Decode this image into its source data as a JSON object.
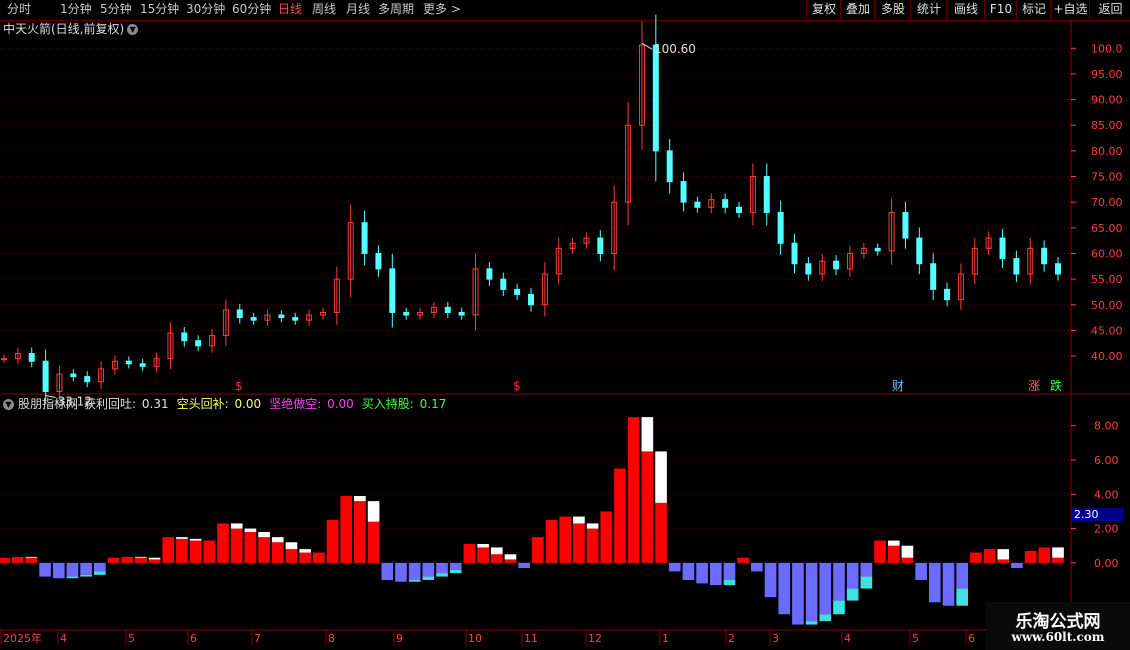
{
  "toolbar": {
    "timeframes": [
      "分时",
      "1分钟",
      "5分钟",
      "15分钟",
      "30分钟",
      "60分钟",
      "日线",
      "周线",
      "月线",
      "多周期",
      "更多 >"
    ],
    "active_timeframe": "日线",
    "buttons": [
      "复权",
      "叠加",
      "多股",
      "统计",
      "画线",
      "F10",
      "标记",
      "+自选",
      "返回"
    ]
  },
  "main_chart": {
    "title": "中天火箭(日线,前复权)",
    "high_label": "100.60",
    "low_label": "33.12",
    "yticks": [
      "100.0",
      "95.00",
      "90.00",
      "85.00",
      "80.00",
      "75.00",
      "70.00",
      "65.00",
      "60.00",
      "55.00",
      "50.00",
      "45.00",
      "40.00"
    ],
    "markers": [
      "$",
      "$",
      "财",
      "涨",
      "跌"
    ]
  },
  "indicator": {
    "name": "股朋指标网",
    "items": [
      {
        "label": "获利回吐:",
        "value": "0.31",
        "color": "#e0e0e0"
      },
      {
        "label": "空头回补:",
        "value": "0.00",
        "color": "#ffff60"
      },
      {
        "label": "坚绝做空:",
        "value": "0.00",
        "color": "#ff40ff"
      },
      {
        "label": "买入持股:",
        "value": "0.17",
        "color": "#40ff40"
      }
    ],
    "yticks": [
      "8.00",
      "6.00",
      "4.00",
      "2.00",
      "0.00"
    ],
    "current_value": "2.30"
  },
  "xaxis": {
    "labels": [
      "2025年",
      "4",
      "5",
      "6",
      "7",
      "8",
      "9",
      "10",
      "11",
      "12",
      "1",
      "2",
      "3",
      "4",
      "5",
      "6"
    ]
  },
  "watermark": {
    "line1": "乐淘公式网",
    "line2": "www.60lt.com"
  },
  "colors": {
    "up": "#ff3c3c",
    "down": "#54ffff",
    "hist_pos": "#ff0000",
    "hist_neg": "#6b6bff",
    "grid": "#5a0000"
  },
  "chart_data": {
    "type": "candlestick",
    "price_series": [
      {
        "x": "2025-03",
        "close": 39.5
      },
      {
        "x": "2025-03",
        "close": 40.5
      },
      {
        "x": "2025-03",
        "close": 39.0
      },
      {
        "x": "2025-04",
        "close": 33.1
      },
      {
        "x": "2025-04",
        "close": 36.5
      },
      {
        "x": "2025-04",
        "close": 36.0
      },
      {
        "x": "2025-04",
        "close": 35.0
      },
      {
        "x": "2025-04",
        "close": 37.5
      },
      {
        "x": "2025-05",
        "close": 39.0
      },
      {
        "x": "2025-05",
        "close": 38.5
      },
      {
        "x": "2025-05",
        "close": 38.0
      },
      {
        "x": "2025-05",
        "close": 39.5
      },
      {
        "x": "2025-06",
        "close": 44.5
      },
      {
        "x": "2025-06",
        "close": 43.0
      },
      {
        "x": "2025-06",
        "close": 42.0
      },
      {
        "x": "2025-06",
        "close": 44.0
      },
      {
        "x": "2025-07",
        "close": 49.0
      },
      {
        "x": "2025-07",
        "close": 47.5
      },
      {
        "x": "2025-07",
        "close": 47.0
      },
      {
        "x": "2025-07",
        "close": 48.0
      },
      {
        "x": "2025-07",
        "close": 47.5
      },
      {
        "x": "2025-08",
        "close": 47.0
      },
      {
        "x": "2025-08",
        "close": 48.0
      },
      {
        "x": "2025-08",
        "close": 48.5
      },
      {
        "x": "2025-08",
        "close": 55.0
      },
      {
        "x": "2025-08",
        "close": 66.0
      },
      {
        "x": "2025-09",
        "close": 60.0
      },
      {
        "x": "2025-09",
        "close": 57.0
      },
      {
        "x": "2025-09",
        "close": 48.5
      },
      {
        "x": "2025-09",
        "close": 48.0
      },
      {
        "x": "2025-10",
        "close": 48.5
      },
      {
        "x": "2025-10",
        "close": 49.5
      },
      {
        "x": "2025-10",
        "close": 48.5
      },
      {
        "x": "2025-10",
        "close": 48.0
      },
      {
        "x": "2025-11",
        "close": 57.0
      },
      {
        "x": "2025-11",
        "close": 55.0
      },
      {
        "x": "2025-11",
        "close": 53.0
      },
      {
        "x": "2025-11",
        "close": 52.0
      },
      {
        "x": "2025-11",
        "close": 50.0
      },
      {
        "x": "2025-12",
        "close": 56.0
      },
      {
        "x": "2025-12",
        "close": 61.0
      },
      {
        "x": "2025-12",
        "close": 62.0
      },
      {
        "x": "2025-12",
        "close": 63.0
      },
      {
        "x": "2025-12",
        "close": 60.0
      },
      {
        "x": "2026-01",
        "close": 70.0
      },
      {
        "x": "2026-01",
        "close": 85.0
      },
      {
        "x": "2026-01",
        "close": 100.6
      },
      {
        "x": "2026-01",
        "close": 80.0
      },
      {
        "x": "2026-01",
        "close": 74.0
      },
      {
        "x": "2026-02",
        "close": 70.0
      },
      {
        "x": "2026-02",
        "close": 69.0
      },
      {
        "x": "2026-02",
        "close": 70.5
      },
      {
        "x": "2026-02",
        "close": 69.0
      },
      {
        "x": "2026-03",
        "close": 68.0
      },
      {
        "x": "2026-03",
        "close": 75.0
      },
      {
        "x": "2026-03",
        "close": 68.0
      },
      {
        "x": "2026-03",
        "close": 62.0
      },
      {
        "x": "2026-03",
        "close": 58.0
      },
      {
        "x": "2026-04",
        "close": 56.0
      },
      {
        "x": "2026-04",
        "close": 58.5
      },
      {
        "x": "2026-04",
        "close": 57.0
      },
      {
        "x": "2026-04",
        "close": 60.0
      },
      {
        "x": "2026-04",
        "close": 61.0
      },
      {
        "x": "2026-05",
        "close": 60.5
      },
      {
        "x": "2026-05",
        "close": 68.0
      },
      {
        "x": "2026-05",
        "close": 63.0
      },
      {
        "x": "2026-05",
        "close": 58.0
      },
      {
        "x": "2026-05",
        "close": 53.0
      },
      {
        "x": "2026-05",
        "close": 51.0
      },
      {
        "x": "2026-06",
        "close": 56.0
      },
      {
        "x": "2026-06",
        "close": 61.0
      },
      {
        "x": "2026-06",
        "close": 63.0
      },
      {
        "x": "2026-06",
        "close": 59.0
      },
      {
        "x": "2026-06",
        "close": 56.0
      },
      {
        "x": "2026-06",
        "close": 61.0
      },
      {
        "x": "2026-06",
        "close": 58.0
      },
      {
        "x": "2026-06",
        "close": 56.0
      }
    ],
    "hist_series": [
      0.3,
      0.35,
      0.3,
      -0.8,
      -0.9,
      -0.8,
      -0.7,
      -0.5,
      0.3,
      0.35,
      0.3,
      0.2,
      1.5,
      1.4,
      1.3,
      1.3,
      2.3,
      2.0,
      1.8,
      1.5,
      1.2,
      0.8,
      0.6,
      0.6,
      2.5,
      3.9,
      3.6,
      2.4,
      -1.0,
      -1.1,
      -1.0,
      -0.8,
      -0.6,
      -0.4,
      1.1,
      0.9,
      0.5,
      0.2,
      -0.3,
      1.5,
      2.5,
      2.7,
      2.3,
      2.0,
      3.0,
      5.5,
      8.5,
      6.5,
      3.5,
      -0.5,
      -1.0,
      -1.2,
      -1.3,
      -1.0,
      0.3,
      -0.5,
      -2.0,
      -3.0,
      -3.6,
      -3.4,
      -3.0,
      -2.2,
      -1.5,
      -0.8,
      1.3,
      1.0,
      0.3,
      -1.0,
      -2.3,
      -2.5,
      -1.5,
      0.6,
      0.8,
      0.2,
      -0.3,
      0.7,
      0.9,
      0.3
    ],
    "ylim": [
      33,
      102
    ],
    "hist_ylim": [
      -3.8,
      8.8
    ]
  }
}
